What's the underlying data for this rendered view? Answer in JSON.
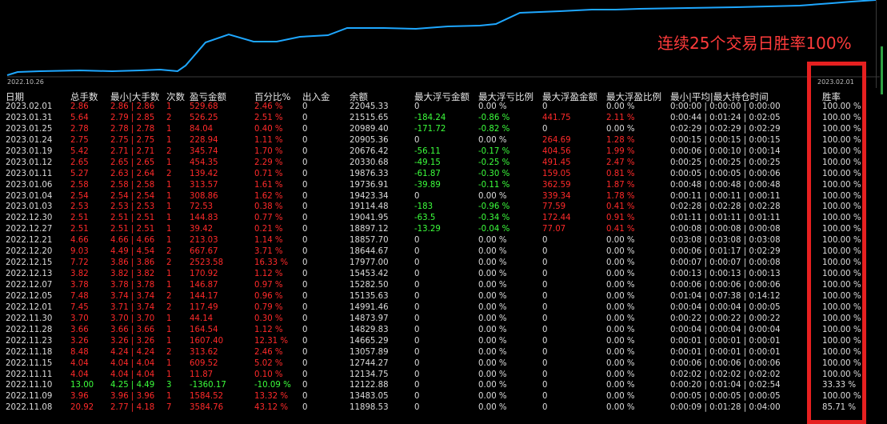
{
  "chart": {
    "start_date": "2022.10.26",
    "end_date": "2023.02.01",
    "line_color": "#1ea7ff"
  },
  "overlay_text": "连续25个交易日胜率100%",
  "headers": {
    "date": "日期",
    "total": "总手数",
    "minmax": "最小|大手数",
    "count": "次数",
    "pnl": "盈亏金额",
    "pct": "百分比%",
    "io": "出入金",
    "balance": "余额",
    "max_float_loss": "最大浮亏金额",
    "max_float_loss_ratio": "最大浮亏比例",
    "max_float_profit": "最大浮盈金额",
    "max_float_profit_ratio": "最大浮盈比例",
    "hold_time": "最小|平均|最大持仓时间",
    "win_rate": "胜率"
  },
  "colors": {
    "red": "#ff2a2a",
    "green": "#3cff3c",
    "box": "#e62020"
  },
  "rows": [
    {
      "date": "2023.02.01",
      "total": "2.86",
      "minmax": "2.86 | 2.86",
      "count": "1",
      "pnl": "529.68",
      "pct": "2.46 %",
      "io": "0",
      "balance": "22045.33",
      "fl": "0",
      "flr": "0.00 %",
      "fp": "0",
      "fpr": "0.00 %",
      "hold": "0:00:00 | 0:00:00 | 0:00:00",
      "win": "100.00 %",
      "c": "red",
      "flc": "gray",
      "fpc": "gray"
    },
    {
      "date": "2023.01.31",
      "total": "5.64",
      "minmax": "2.79 | 2.85",
      "count": "2",
      "pnl": "526.25",
      "pct": "2.51 %",
      "io": "0",
      "balance": "21515.65",
      "fl": "-184.24",
      "flr": "-0.86 %",
      "fp": "441.75",
      "fpr": "2.11 %",
      "hold": "0:00:44 | 0:01:24 | 0:02:05",
      "win": "100.00 %",
      "c": "red",
      "flc": "green",
      "fpc": "red"
    },
    {
      "date": "2023.01.25",
      "total": "2.78",
      "minmax": "2.78 | 2.78",
      "count": "1",
      "pnl": "84.04",
      "pct": "0.40 %",
      "io": "0",
      "balance": "20989.40",
      "fl": "-171.72",
      "flr": "-0.82 %",
      "fp": "0",
      "fpr": "0.00 %",
      "hold": "0:02:29 | 0:02:29 | 0:02:29",
      "win": "100.00 %",
      "c": "red",
      "flc": "green",
      "fpc": "gray"
    },
    {
      "date": "2023.01.24",
      "total": "2.75",
      "minmax": "2.75 | 2.75",
      "count": "1",
      "pnl": "228.94",
      "pct": "1.11 %",
      "io": "0",
      "balance": "20905.36",
      "fl": "0",
      "flr": "0.00 %",
      "fp": "264.69",
      "fpr": "1.28 %",
      "hold": "0:00:15 | 0:00:15 | 0:00:15",
      "win": "100.00 %",
      "c": "red",
      "flc": "gray",
      "fpc": "red"
    },
    {
      "date": "2023.01.19",
      "total": "5.42",
      "minmax": "2.71 | 2.71",
      "count": "2",
      "pnl": "345.74",
      "pct": "1.70 %",
      "io": "0",
      "balance": "20676.42",
      "fl": "-56.11",
      "flr": "-0.17 %",
      "fp": "404.56",
      "fpr": "1.99 %",
      "hold": "0:00:06 | 0:00:10 | 0:00:14",
      "win": "100.00 %",
      "c": "red",
      "flc": "green",
      "fpc": "red"
    },
    {
      "date": "2023.01.12",
      "total": "2.65",
      "minmax": "2.65 | 2.65",
      "count": "1",
      "pnl": "454.35",
      "pct": "2.29 %",
      "io": "0",
      "balance": "20330.68",
      "fl": "-49.15",
      "flr": "-0.25 %",
      "fp": "491.45",
      "fpr": "2.47 %",
      "hold": "0:00:25 | 0:00:25 | 0:00:25",
      "win": "100.00 %",
      "c": "red",
      "flc": "green",
      "fpc": "red"
    },
    {
      "date": "2023.01.11",
      "total": "5.27",
      "minmax": "2.63 | 2.64",
      "count": "2",
      "pnl": "139.42",
      "pct": "0.71 %",
      "io": "0",
      "balance": "19876.33",
      "fl": "-61.87",
      "flr": "-0.30 %",
      "fp": "159.05",
      "fpr": "0.81 %",
      "hold": "0:00:05 | 0:00:05 | 0:00:06",
      "win": "100.00 %",
      "c": "red",
      "flc": "green",
      "fpc": "red"
    },
    {
      "date": "2023.01.06",
      "total": "2.58",
      "minmax": "2.58 | 2.58",
      "count": "1",
      "pnl": "313.57",
      "pct": "1.61 %",
      "io": "0",
      "balance": "19736.91",
      "fl": "-39.89",
      "flr": "-0.11 %",
      "fp": "362.59",
      "fpr": "1.87 %",
      "hold": "0:00:48 | 0:00:48 | 0:00:48",
      "win": "100.00 %",
      "c": "red",
      "flc": "green",
      "fpc": "red"
    },
    {
      "date": "2023.01.04",
      "total": "2.54",
      "minmax": "2.54 | 2.54",
      "count": "1",
      "pnl": "308.86",
      "pct": "1.62 %",
      "io": "0",
      "balance": "19423.34",
      "fl": "0",
      "flr": "0.00 %",
      "fp": "339.34",
      "fpr": "1.78 %",
      "hold": "0:00:11 | 0:00:11 | 0:00:11",
      "win": "100.00 %",
      "c": "red",
      "flc": "gray",
      "fpc": "red"
    },
    {
      "date": "2023.01.03",
      "total": "2.53",
      "minmax": "2.53 | 2.53",
      "count": "1",
      "pnl": "72.53",
      "pct": "0.38 %",
      "io": "0",
      "balance": "19114.48",
      "fl": "-183",
      "flr": "-0.96 %",
      "fp": "77.59",
      "fpr": "0.41 %",
      "hold": "0:02:28 | 0:02:28 | 0:02:28",
      "win": "100.00 %",
      "c": "red",
      "flc": "green",
      "fpc": "red"
    },
    {
      "date": "2022.12.30",
      "total": "2.51",
      "minmax": "2.51 | 2.51",
      "count": "1",
      "pnl": "144.83",
      "pct": "0.77 %",
      "io": "0",
      "balance": "19041.95",
      "fl": "-63.5",
      "flr": "-0.34 %",
      "fp": "172.44",
      "fpr": "0.91 %",
      "hold": "0:01:11 | 0:01:11 | 0:01:11",
      "win": "100.00 %",
      "c": "red",
      "flc": "green",
      "fpc": "red"
    },
    {
      "date": "2022.12.27",
      "total": "2.51",
      "minmax": "2.51 | 2.51",
      "count": "1",
      "pnl": "39.42",
      "pct": "0.21 %",
      "io": "0",
      "balance": "18897.12",
      "fl": "-13.29",
      "flr": "-0.04 %",
      "fp": "77.07",
      "fpr": "0.41 %",
      "hold": "0:00:08 | 0:00:08 | 0:00:08",
      "win": "100.00 %",
      "c": "red",
      "flc": "green",
      "fpc": "red"
    },
    {
      "date": "2022.12.21",
      "total": "4.66",
      "minmax": "4.66 | 4.66",
      "count": "1",
      "pnl": "213.03",
      "pct": "1.14 %",
      "io": "0",
      "balance": "18857.70",
      "fl": "0",
      "flr": "0.00 %",
      "fp": "0",
      "fpr": "0.00 %",
      "hold": "0:03:08 | 0:03:08 | 0:03:08",
      "win": "100.00 %",
      "c": "red",
      "flc": "gray",
      "fpc": "gray"
    },
    {
      "date": "2022.12.20",
      "total": "9.03",
      "minmax": "4.49 | 4.54",
      "count": "2",
      "pnl": "667.67",
      "pct": "3.71 %",
      "io": "0",
      "balance": "18644.67",
      "fl": "0",
      "flr": "0.00 %",
      "fp": "0",
      "fpr": "0.00 %",
      "hold": "0:00:06 | 0:01:17 | 0:02:29",
      "win": "100.00 %",
      "c": "red",
      "flc": "gray",
      "fpc": "gray"
    },
    {
      "date": "2022.12.15",
      "total": "7.72",
      "minmax": "3.86 | 3.86",
      "count": "2",
      "pnl": "2523.58",
      "pct": "16.33 %",
      "io": "0",
      "balance": "17977.00",
      "fl": "0",
      "flr": "0.00 %",
      "fp": "0",
      "fpr": "0.00 %",
      "hold": "0:00:07 | 0:00:07 | 0:00:08",
      "win": "100.00 %",
      "c": "red",
      "flc": "gray",
      "fpc": "gray"
    },
    {
      "date": "2022.12.13",
      "total": "3.82",
      "minmax": "3.82 | 3.82",
      "count": "1",
      "pnl": "170.92",
      "pct": "1.12 %",
      "io": "0",
      "balance": "15453.42",
      "fl": "0",
      "flr": "0.00 %",
      "fp": "0",
      "fpr": "0.00 %",
      "hold": "0:00:13 | 0:00:13 | 0:00:13",
      "win": "100.00 %",
      "c": "red",
      "flc": "gray",
      "fpc": "gray"
    },
    {
      "date": "2022.12.07",
      "total": "3.78",
      "minmax": "3.78 | 3.78",
      "count": "1",
      "pnl": "146.87",
      "pct": "0.97 %",
      "io": "0",
      "balance": "15282.50",
      "fl": "0",
      "flr": "0.00 %",
      "fp": "0",
      "fpr": "0.00 %",
      "hold": "0:00:06 | 0:00:06 | 0:00:06",
      "win": "100.00 %",
      "c": "red",
      "flc": "gray",
      "fpc": "gray"
    },
    {
      "date": "2022.12.05",
      "total": "7.48",
      "minmax": "3.74 | 3.74",
      "count": "2",
      "pnl": "144.17",
      "pct": "0.96 %",
      "io": "0",
      "balance": "15135.63",
      "fl": "0",
      "flr": "0.00 %",
      "fp": "0",
      "fpr": "0.00 %",
      "hold": "0:01:04 | 0:07:38 | 0:14:12",
      "win": "100.00 %",
      "c": "red",
      "flc": "gray",
      "fpc": "gray"
    },
    {
      "date": "2022.12.01",
      "total": "7.45",
      "minmax": "3.71 | 3.74",
      "count": "2",
      "pnl": "117.49",
      "pct": "0.79 %",
      "io": "0",
      "balance": "14991.46",
      "fl": "0",
      "flr": "0.00 %",
      "fp": "0",
      "fpr": "0.00 %",
      "hold": "0:00:04 | 0:00:04 | 0:00:05",
      "win": "100.00 %",
      "c": "red",
      "flc": "gray",
      "fpc": "gray"
    },
    {
      "date": "2022.11.30",
      "total": "3.70",
      "minmax": "3.70 | 3.70",
      "count": "1",
      "pnl": "44.14",
      "pct": "0.30 %",
      "io": "0",
      "balance": "14873.97",
      "fl": "0",
      "flr": "0.00 %",
      "fp": "0",
      "fpr": "0.00 %",
      "hold": "0:00:22 | 0:00:22 | 0:00:22",
      "win": "100.00 %",
      "c": "red",
      "flc": "gray",
      "fpc": "gray"
    },
    {
      "date": "2022.11.28",
      "total": "3.66",
      "minmax": "3.66 | 3.66",
      "count": "1",
      "pnl": "164.54",
      "pct": "1.12 %",
      "io": "0",
      "balance": "14829.83",
      "fl": "0",
      "flr": "0.00 %",
      "fp": "0",
      "fpr": "0.00 %",
      "hold": "0:00:04 | 0:00:04 | 0:00:04",
      "win": "100.00 %",
      "c": "red",
      "flc": "gray",
      "fpc": "gray"
    },
    {
      "date": "2022.11.23",
      "total": "3.26",
      "minmax": "3.26 | 3.26",
      "count": "1",
      "pnl": "1607.40",
      "pct": "12.31 %",
      "io": "0",
      "balance": "14665.29",
      "fl": "0",
      "flr": "0.00 %",
      "fp": "0",
      "fpr": "0.00 %",
      "hold": "0:00:01 | 0:00:01 | 0:00:01",
      "win": "100.00 %",
      "c": "red",
      "flc": "gray",
      "fpc": "gray"
    },
    {
      "date": "2022.11.18",
      "total": "8.48",
      "minmax": "4.24 | 4.24",
      "count": "2",
      "pnl": "313.62",
      "pct": "2.46 %",
      "io": "0",
      "balance": "13057.89",
      "fl": "0",
      "flr": "0.00 %",
      "fp": "0",
      "fpr": "0.00 %",
      "hold": "0:00:01 | 0:00:01 | 0:00:01",
      "win": "100.00 %",
      "c": "red",
      "flc": "gray",
      "fpc": "gray"
    },
    {
      "date": "2022.11.15",
      "total": "4.04",
      "minmax": "4.04 | 4.04",
      "count": "1",
      "pnl": "609.52",
      "pct": "5.02 %",
      "io": "0",
      "balance": "12744.27",
      "fl": "0",
      "flr": "0.00 %",
      "fp": "0",
      "fpr": "0.00 %",
      "hold": "0:00:06 | 0:00:06 | 0:00:06",
      "win": "100.00 %",
      "c": "red",
      "flc": "gray",
      "fpc": "gray"
    },
    {
      "date": "2022.11.11",
      "total": "4.04",
      "minmax": "4.04 | 4.04",
      "count": "1",
      "pnl": "11.87",
      "pct": "0.10 %",
      "io": "0",
      "balance": "12134.75",
      "fl": "0",
      "flr": "0.00 %",
      "fp": "0",
      "fpr": "0.00 %",
      "hold": "0:02:02 | 0:02:02 | 0:02:02",
      "win": "100.00 %",
      "c": "red",
      "flc": "gray",
      "fpc": "gray"
    },
    {
      "date": "2022.11.10",
      "total": "13.00",
      "minmax": "4.25 | 4.49",
      "count": "3",
      "pnl": "-1360.17",
      "pct": "-10.09 %",
      "io": "0",
      "balance": "12122.88",
      "fl": "0",
      "flr": "0.00 %",
      "fp": "0",
      "fpr": "0.00 %",
      "hold": "0:00:20 | 0:01:04 | 0:02:54",
      "win": "33.33 %",
      "c": "green",
      "flc": "gray",
      "fpc": "gray"
    },
    {
      "date": "2022.11.09",
      "total": "3.96",
      "minmax": "3.96 | 3.96",
      "count": "1",
      "pnl": "1584.52",
      "pct": "13.32 %",
      "io": "0",
      "balance": "13483.05",
      "fl": "0",
      "flr": "0.00 %",
      "fp": "0",
      "fpr": "0.00 %",
      "hold": "0:00:05 | 0:00:05 | 0:00:05",
      "win": "100.00 %",
      "c": "red",
      "flc": "gray",
      "fpc": "gray"
    },
    {
      "date": "2022.11.08",
      "total": "20.92",
      "minmax": "2.77 | 4.18",
      "count": "7",
      "pnl": "3584.76",
      "pct": "43.12 %",
      "io": "0",
      "balance": "11898.53",
      "fl": "0",
      "flr": "0.00 %",
      "fp": "0",
      "fpr": "0.00 %",
      "hold": "0:00:09 | 0:01:28 | 0:04:00",
      "win": "85.71 %",
      "c": "red",
      "flc": "gray",
      "fpc": "gray"
    }
  ]
}
